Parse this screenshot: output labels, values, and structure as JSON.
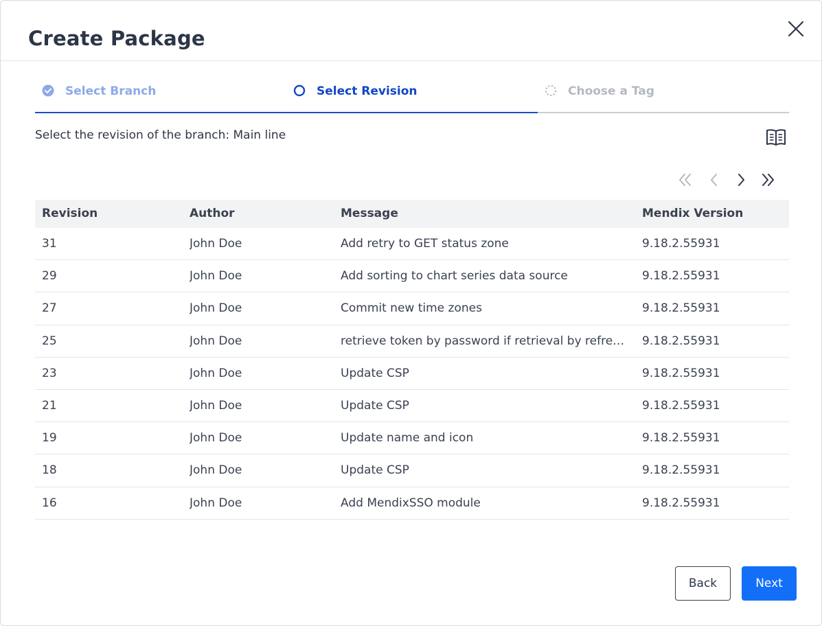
{
  "dialog": {
    "title": "Create Package"
  },
  "stepper": {
    "steps": [
      {
        "label": "Select Branch",
        "state": "completed"
      },
      {
        "label": "Select Revision",
        "state": "active"
      },
      {
        "label": "Choose a Tag",
        "state": "pending"
      }
    ]
  },
  "instruction": "Select the revision of the branch: Main line",
  "icons": {
    "close": "close-icon",
    "docs": "book-icon",
    "first": "double-chevron-left-icon",
    "prev": "chevron-left-icon",
    "next": "chevron-right-icon",
    "last": "double-chevron-right-icon"
  },
  "table": {
    "headers": [
      "Revision",
      "Author",
      "Message",
      "Mendix Version"
    ],
    "rows": [
      [
        "31",
        "John Doe",
        "Add retry to GET status zone",
        "9.18.2.55931"
      ],
      [
        "29",
        "John Doe",
        "Add sorting to chart series data source",
        "9.18.2.55931"
      ],
      [
        "27",
        "John Doe",
        "Commit new time zones",
        "9.18.2.55931"
      ],
      [
        "25",
        "John Doe",
        "retrieve token by password if retrieval by refresh ...",
        "9.18.2.55931"
      ],
      [
        "23",
        "John Doe",
        "Update CSP",
        "9.18.2.55931"
      ],
      [
        "21",
        "John Doe",
        "Update CSP",
        "9.18.2.55931"
      ],
      [
        "19",
        "John Doe",
        "Update name and icon",
        "9.18.2.55931"
      ],
      [
        "18",
        "John Doe",
        "Update CSP",
        "9.18.2.55931"
      ],
      [
        "16",
        "John Doe",
        "Add MendixSSO module",
        "9.18.2.55931"
      ]
    ]
  },
  "footer": {
    "back_label": "Back",
    "next_label": "Next"
  },
  "colors": {
    "primary": "#146ff8",
    "active_step": "#1146c8",
    "completed_step": "#8ea9e6",
    "pending_step": "#b4b9c1"
  }
}
